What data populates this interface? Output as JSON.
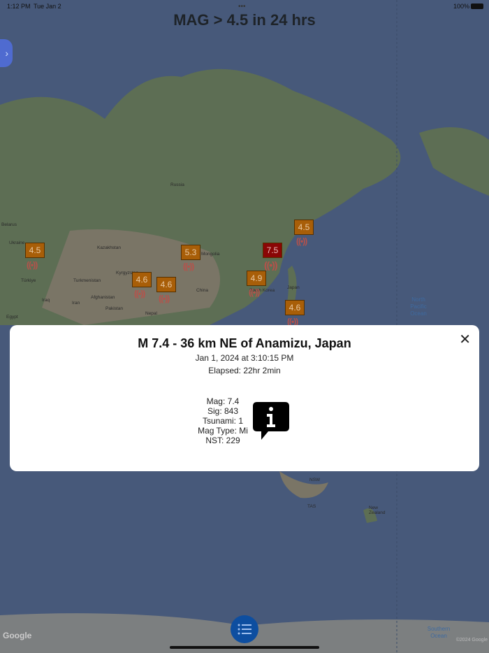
{
  "status_bar": {
    "time": "1:12 PM",
    "date": "Tue Jan 2",
    "battery": "100%"
  },
  "title": "MAG > 4.5 in 24 hrs",
  "markers": [
    {
      "mag": "4.5"
    },
    {
      "mag": "5.3"
    },
    {
      "mag": "4.6"
    },
    {
      "mag": "4.6"
    },
    {
      "mag": "4.9"
    },
    {
      "mag": "7.5"
    },
    {
      "mag": "4.5"
    },
    {
      "mag": "4.6"
    }
  ],
  "map_labels": {
    "russia": "Russia",
    "kazakhstan": "Kazakhstan",
    "belarus": "Belarus",
    "ukraine": "Ukraine",
    "turkiye": "Türkiye",
    "turkmenistan": "Turkmenistan",
    "kyrgyzstan": "Kyrgyzstan",
    "afghanistan": "Afghanistan",
    "iraq": "Iraq",
    "iran": "Iran",
    "pakistan": "Pakistan",
    "nepal": "Nepal",
    "china": "China",
    "mongolia": "Mongolia",
    "south_korea": "South Korea",
    "japan": "Japan",
    "egypt": "Egypt",
    "north_pacific": "North Pacific Ocean",
    "southern_ocean": "Southern Ocean",
    "new_zealand": "New Zealand",
    "nsw": "NSW",
    "tas": "TAS"
  },
  "modal": {
    "title": "M 7.4 - 36 km NE of Anamizu, Japan",
    "date": "Jan 1, 2024 at 3:10:15 PM",
    "elapsed": "Elapsed: 22hr 2min",
    "stats": [
      "Mag: 7.4",
      "Sig: 843",
      "Tsunami: 1",
      "Mag Type: Mi",
      "NST: 229"
    ]
  },
  "attribution": {
    "google": "Google",
    "copyright": "©2024 Google"
  }
}
